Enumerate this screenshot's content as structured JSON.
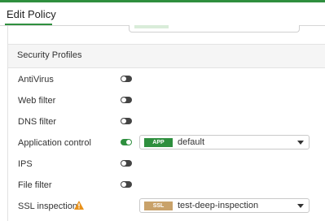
{
  "dialog": {
    "title": "Edit Policy"
  },
  "colors": {
    "accent": "#2e8f3e",
    "toggle_off": "#444444",
    "ssl_badge": "#c9a26a",
    "warning": "#e8911a"
  },
  "security_profiles": {
    "heading": "Security Profiles",
    "rows": [
      {
        "label": "AntiVirus",
        "enabled": false
      },
      {
        "label": "Web filter",
        "enabled": false
      },
      {
        "label": "DNS filter",
        "enabled": false
      },
      {
        "label": "Application control",
        "enabled": true,
        "select": {
          "badge": "APP",
          "value": "default"
        }
      },
      {
        "label": "IPS",
        "enabled": false
      },
      {
        "label": "File filter",
        "enabled": false
      },
      {
        "label": "SSL inspection",
        "warning_icon": "warning-triangle-icon",
        "select": {
          "badge": "SSL",
          "value": "test-deep-inspection"
        }
      }
    ]
  }
}
